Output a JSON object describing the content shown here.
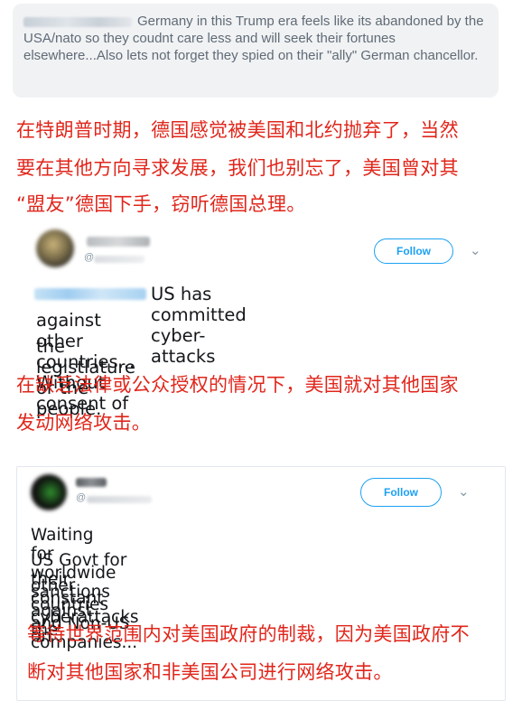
{
  "tweet1": {
    "text": "Germany in this Trump era feels like its abandoned by the USA/nato so they coudnt care less and will seek their fortunes elsewhere...Also lets not forget they spied on their \"ally\" German chancellor."
  },
  "translation1": {
    "line1": "在特朗普时期，德国感觉被美国和北约抛弃了，当然",
    "line2": "要在其他方向寻求发展，我们也别忘了，美国曾对其",
    "line3": "“盟友”德国下手，窃听德国总理。"
  },
  "tweet2": {
    "follow_label": "Follow",
    "at_sign": "@",
    "line1": "US has committed cyber-attacks",
    "line2": "against other countries... Without consent of",
    "line3": "the legistlature or the people."
  },
  "translation2": {
    "line1": "在缺乏法律或公众授权的情况下，美国就对其他国家",
    "line2": "发动网络攻击。"
  },
  "tweet3": {
    "follow_label": "Follow",
    "at_sign": "@",
    "line1": "Waiting for worldwide sanctions against the",
    "line2": "US Govt for their constant cyberattacks on",
    "line3": "other countries and Non-US companies..."
  },
  "translation3": {
    "line1": "等待世界范围内对美国政府的制裁，因为美国政府不",
    "line2": "断对其他国家和非美国公司进行网络攻击。"
  },
  "colors": {
    "translation_red": "#e0261b",
    "twitter_blue": "#1da1f2"
  },
  "icons": {
    "menu_chevron": "chevron-down-icon"
  }
}
